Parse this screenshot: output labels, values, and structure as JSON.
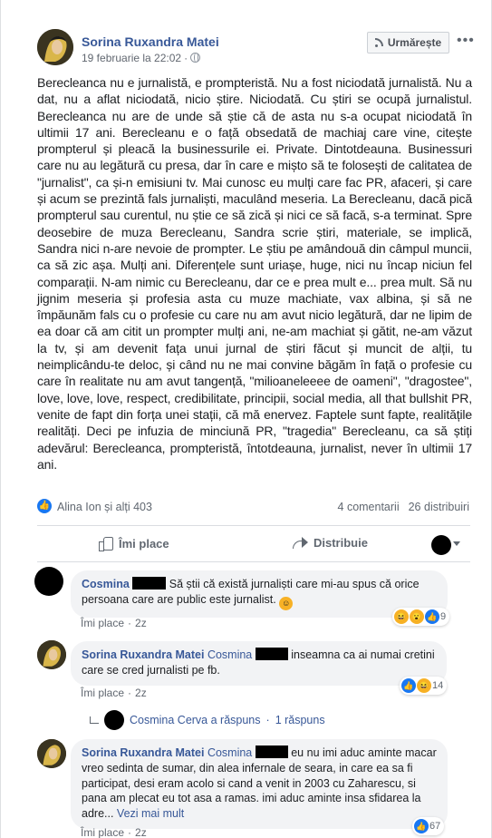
{
  "post": {
    "author": "Sorina Ruxandra Matei",
    "date": "19 februarie la 22:02",
    "follow_label": "Urmărește",
    "more_label": "•••",
    "text": "Berecleanca nu e jurnalistă, e prompteristă. Nu a fost niciodată jurnalistă. Nu a dat, nu a aflat niciodată, nicio știre. Niciodată. Cu știri se ocupă jurnalistul. Berecleanca nu are de unde să știe că de asta nu s-a ocupat niciodată în ultimii 17 ani. Berecleanu e o față obsedată de machiaj care vine, citește prompterul și pleacă la businessurile ei. Private. Dintotdeauna. Businessuri care nu au legătură cu presa, dar în care e mișto să te folosești de calitatea de \"jurnalist\", ca și-n emisiuni tv. Mai cunosc eu mulți care fac PR, afaceri, și care și acum se prezintă fals jurnaliști, maculând meseria. La Berecleanu, dacă pică prompterul sau curentul, nu știe ce să zică și nici ce să facă, s-a terminat. Spre deosebire de muza Berecleanu, Sandra scrie știri, materiale, se implică, Sandra nici n-are nevoie de prompter. Le știu pe amândouă din câmpul muncii, ca să zic așa. Mulți ani. Diferențele sunt uriașe, huge, nici nu încap niciun fel comparații. N-am nimic cu Berecleanu, dar ce e prea mult e... prea mult. Să nu jignim meseria și profesia asta cu muze machiate, vax albina, și să ne împăunăm fals cu o profesie cu care nu am avut nicio legătură, dar ne lipim de ea doar că am citit un prompter mulți ani, ne-am machiat și gătit, ne-am văzut la tv, și am devenit fața unui jurnal de știri făcut și muncit de alții, tu neimplicându-te deloc, și când nu ne mai convine băgăm în față o profesie cu care în realitate nu am avut tangență, \"milioaneleeee de oameni\", \"dragostee\", love, love, love, respect, credibilitate, principii, social media, all that bullshit PR, venite de fapt din forța unei stații, că mă enervez. Faptele sunt fapte, realitățile realități. Deci pe infuzia de minciună PR, \"tragedia\" Berecleanu, ca să știți adevărul: Berecleanca, prompteristă, întotdeauna, jurnalist, never în ultimii 17 ani."
  },
  "stats": {
    "reactors": "Alina Ion și alți 403",
    "comments": "4 comentarii",
    "shares": "26 distribuiri"
  },
  "actions": {
    "like": "Îmi place",
    "share": "Distribuie"
  },
  "comments": [
    {
      "name": "Cosmina",
      "text": "Să știi că există jurnaliști care mi-au spus că orice persoana care are public este jurnalist.",
      "like_label": "Îmi place",
      "age": "2z",
      "reaction_count": "9"
    },
    {
      "name": "Sorina Ruxandra Matei",
      "tag": "Cosmina",
      "text": "inseamna ca ai numai cretini care se cred jurnalisti pe fb.",
      "like_label": "Îmi place",
      "age": "2z",
      "reaction_count": "14"
    },
    {
      "name": "Sorina Ruxandra Matei",
      "tag": "Cosmina",
      "text": "eu nu imi aduc aminte macar vreo sedinta de sumar, din alea infernale de seara, in care ea sa fi participat, desi eram acolo si cand a venit in 2003 cu Zaharescu, si pana am plecat eu tot asa a ramas. imi aduc aminte insa sfidarea la adre...",
      "see_more": "Vezi mai mult",
      "like_label": "Îmi place",
      "age": "2z",
      "reaction_count": "67"
    }
  ],
  "reply_link": {
    "who": "Cosmina Cerva a răspuns",
    "sep": "·",
    "count": "1 răspuns"
  },
  "colors": {
    "link": "#385898",
    "like_blue": "#1877f2",
    "meta": "#606770"
  }
}
